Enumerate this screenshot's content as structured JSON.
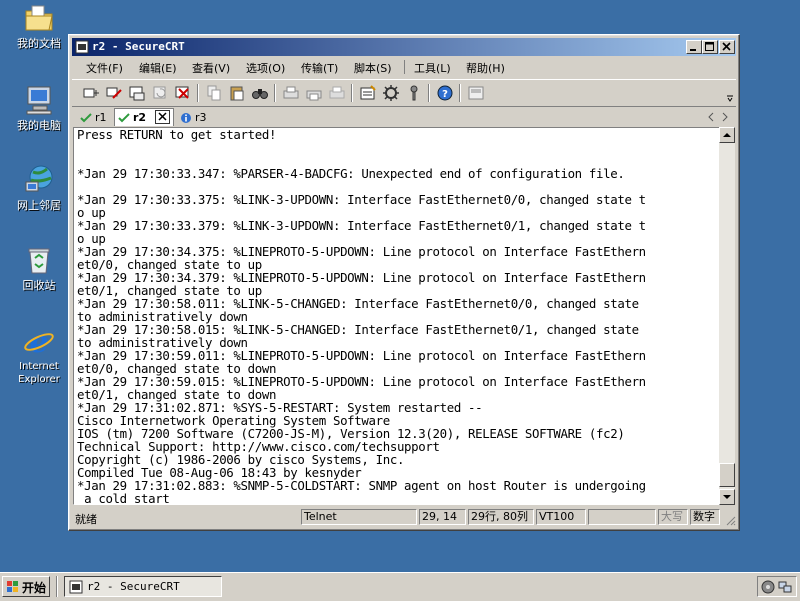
{
  "desktop": {
    "icons": [
      {
        "label": "我的文档",
        "icon": "folder-documents-icon"
      },
      {
        "label": "我的电脑",
        "icon": "computer-icon"
      },
      {
        "label": "网上邻居",
        "icon": "network-icon"
      },
      {
        "label": "回收站",
        "icon": "recycle-bin-icon"
      },
      {
        "label": "Internet\nExplorer",
        "icon": "internet-explorer-icon"
      }
    ]
  },
  "window": {
    "title": "r2 - SecureCRT",
    "menu": [
      "文件(F)",
      "编辑(E)",
      "查看(V)",
      "选项(O)",
      "传输(T)",
      "脚本(S)",
      "工具(L)",
      "帮助(H)"
    ],
    "tabs": [
      {
        "label": "r1",
        "status": "connected"
      },
      {
        "label": "r2",
        "status": "connected-active"
      },
      {
        "label": "r3",
        "status": "info"
      }
    ],
    "terminal_lines": [
      "Press RETURN to get started!",
      "",
      "",
      "*Jan 29 17:30:33.347: %PARSER-4-BADCFG: Unexpected end of configuration file.",
      "",
      "*Jan 29 17:30:33.375: %LINK-3-UPDOWN: Interface FastEthernet0/0, changed state t",
      "o up",
      "*Jan 29 17:30:33.379: %LINK-3-UPDOWN: Interface FastEthernet0/1, changed state t",
      "o up",
      "*Jan 29 17:30:34.375: %LINEPROTO-5-UPDOWN: Line protocol on Interface FastEthern",
      "et0/0, changed state to up",
      "*Jan 29 17:30:34.379: %LINEPROTO-5-UPDOWN: Line protocol on Interface FastEthern",
      "et0/1, changed state to up",
      "*Jan 29 17:30:58.011: %LINK-5-CHANGED: Interface FastEthernet0/0, changed state",
      "to administratively down",
      "*Jan 29 17:30:58.015: %LINK-5-CHANGED: Interface FastEthernet0/1, changed state",
      "to administratively down",
      "*Jan 29 17:30:59.011: %LINEPROTO-5-UPDOWN: Line protocol on Interface FastEthern",
      "et0/0, changed state to down",
      "*Jan 29 17:30:59.015: %LINEPROTO-5-UPDOWN: Line protocol on Interface FastEthern",
      "et0/1, changed state to down",
      "*Jan 29 17:31:02.871: %SYS-5-RESTART: System restarted --",
      "Cisco Internetwork Operating System Software",
      "IOS (tm) 7200 Software (C7200-JS-M), Version 12.3(20), RELEASE SOFTWARE (fc2)",
      "Technical Support: http://www.cisco.com/techsupport",
      "Copyright (c) 1986-2006 by cisco Systems, Inc.",
      "Compiled Tue 08-Aug-06 18:43 by kesnyder",
      "*Jan 29 17:31:02.883: %SNMP-5-COLDSTART: SNMP agent on host Router is undergoing",
      " a cold start"
    ],
    "status": {
      "ready": "就绪",
      "protocol": "Telnet",
      "cursor": "29, 14",
      "size": "29行, 80列",
      "emulation": "VT100",
      "caps": "大写",
      "num": "数字"
    }
  },
  "taskbar": {
    "start_label": "开始",
    "task_label": "r2 - SecureCRT"
  },
  "colors": {
    "desktop": "#3a6ea5",
    "titlebar_start": "#0a246a",
    "titlebar_end": "#a6caf0",
    "chrome": "#d4d0c8"
  }
}
